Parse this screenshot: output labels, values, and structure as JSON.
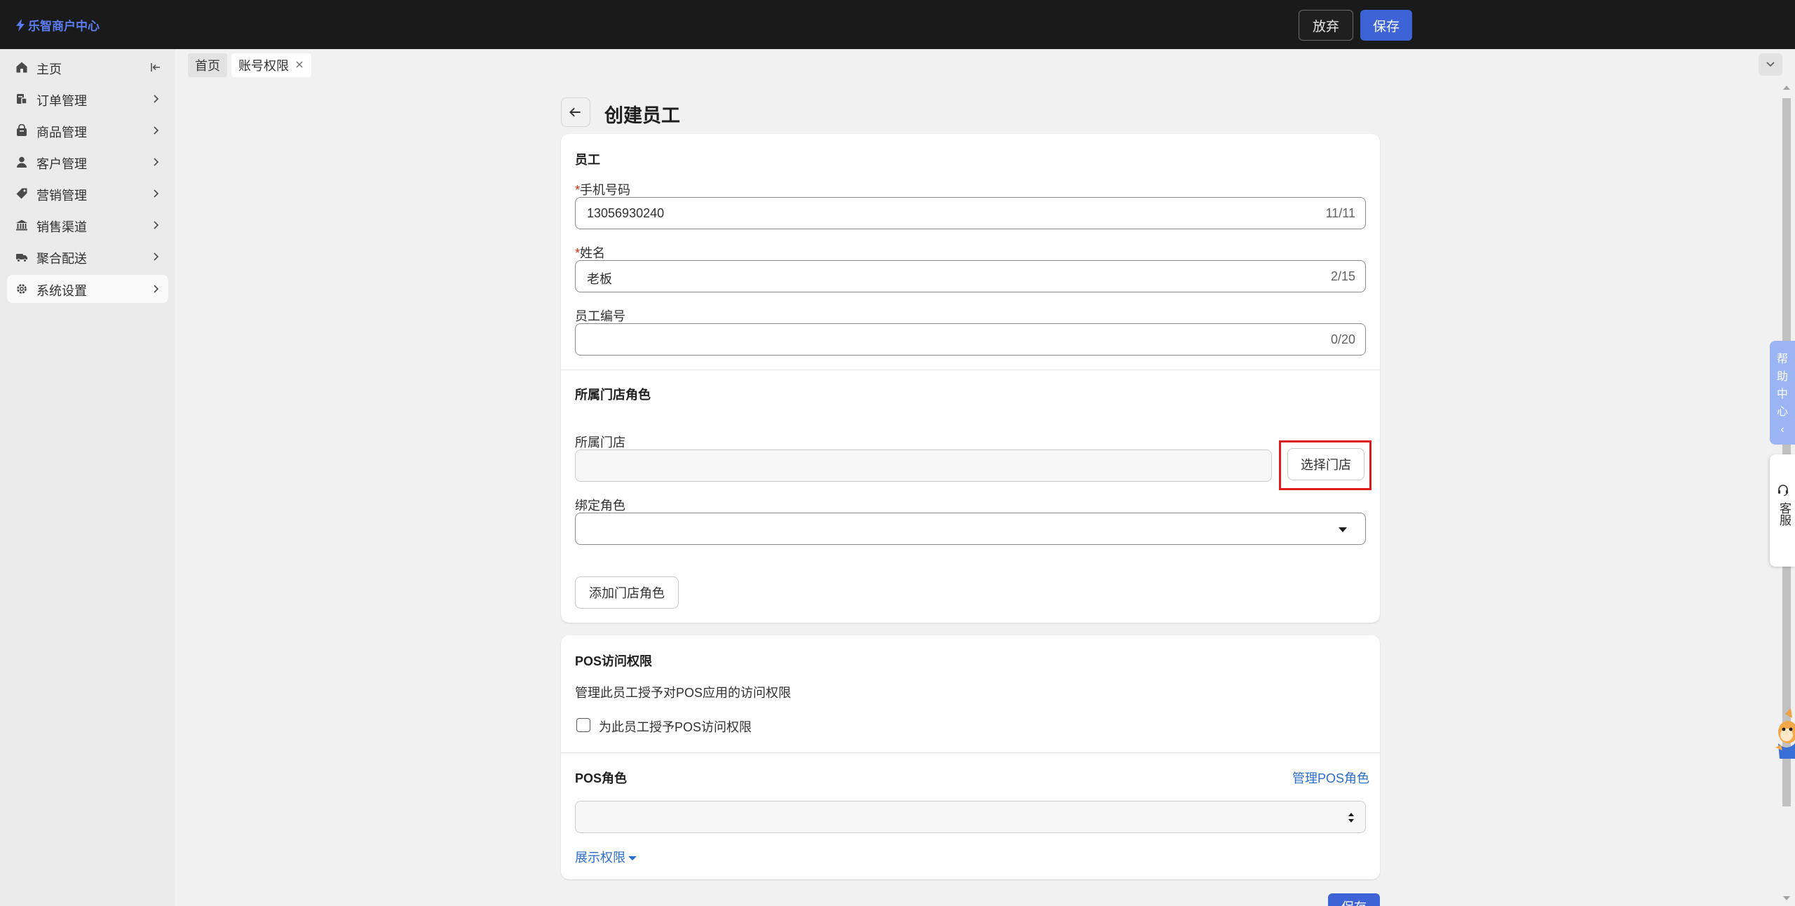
{
  "app": {
    "brand": "乐智商户中心"
  },
  "toolbar": {
    "discard_label": "放弃",
    "save_label": "保存"
  },
  "sidebar": {
    "items": [
      {
        "label": "主页",
        "icon": "home-icon"
      },
      {
        "label": "订单管理",
        "icon": "order-icon"
      },
      {
        "label": "商品管理",
        "icon": "product-icon"
      },
      {
        "label": "客户管理",
        "icon": "customer-icon"
      },
      {
        "label": "营销管理",
        "icon": "tag-icon"
      },
      {
        "label": "销售渠道",
        "icon": "store-icon"
      },
      {
        "label": "聚合配送",
        "icon": "delivery-icon"
      },
      {
        "label": "系统设置",
        "icon": "gear-icon"
      }
    ],
    "active_index": 7
  },
  "tabs": [
    {
      "label": "首页"
    },
    {
      "label": "账号权限"
    }
  ],
  "page": {
    "title": "创建员工"
  },
  "employee": {
    "section_title": "员工",
    "phone": {
      "label": "手机号码",
      "value": "13056930240",
      "count": "11/11"
    },
    "name": {
      "label": "姓名",
      "value": "老板",
      "count": "2/15"
    },
    "employee_no": {
      "label": "员工编号",
      "value": "",
      "count": "0/20"
    },
    "required_mark": "*"
  },
  "store_role": {
    "section_title": "所属门店角色",
    "store_label": "所属门店",
    "choose_store_button": "选择门店",
    "role_label": "绑定角色",
    "add_button": "添加门店角色"
  },
  "pos": {
    "section_title": "POS访问权限",
    "description": "管理此员工授予对POS应用的访问权限",
    "checkbox_label": "为此员工授予POS访问权限",
    "checkbox_checked": false,
    "role_title": "POS角色",
    "manage_link": "管理POS角色",
    "expand_link": "展示权限"
  },
  "widgets": {
    "help_center": [
      "帮",
      "助",
      "中",
      "心",
      "‹"
    ],
    "customer_service": "客服"
  },
  "colors": {
    "primary": "#3e63d6",
    "link": "#2c6ecb",
    "required": "#d72c0d",
    "highlight": "#e01b1b"
  }
}
